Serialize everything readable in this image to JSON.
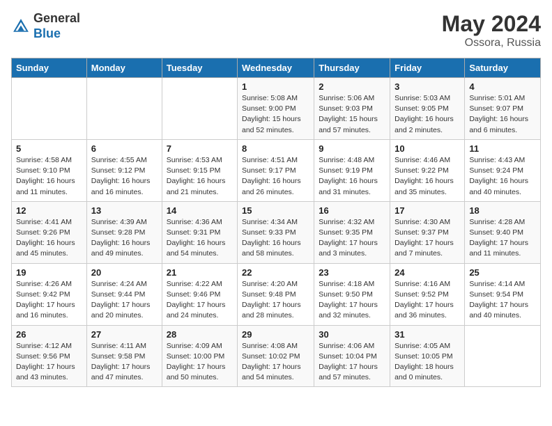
{
  "logo": {
    "general": "General",
    "blue": "Blue"
  },
  "title": {
    "month_year": "May 2024",
    "location": "Ossora, Russia"
  },
  "weekdays": [
    "Sunday",
    "Monday",
    "Tuesday",
    "Wednesday",
    "Thursday",
    "Friday",
    "Saturday"
  ],
  "weeks": [
    [
      {
        "day": "",
        "info": ""
      },
      {
        "day": "",
        "info": ""
      },
      {
        "day": "",
        "info": ""
      },
      {
        "day": "1",
        "info": "Sunrise: 5:08 AM\nSunset: 9:00 PM\nDaylight: 15 hours\nand 52 minutes."
      },
      {
        "day": "2",
        "info": "Sunrise: 5:06 AM\nSunset: 9:03 PM\nDaylight: 15 hours\nand 57 minutes."
      },
      {
        "day": "3",
        "info": "Sunrise: 5:03 AM\nSunset: 9:05 PM\nDaylight: 16 hours\nand 2 minutes."
      },
      {
        "day": "4",
        "info": "Sunrise: 5:01 AM\nSunset: 9:07 PM\nDaylight: 16 hours\nand 6 minutes."
      }
    ],
    [
      {
        "day": "5",
        "info": "Sunrise: 4:58 AM\nSunset: 9:10 PM\nDaylight: 16 hours\nand 11 minutes."
      },
      {
        "day": "6",
        "info": "Sunrise: 4:55 AM\nSunset: 9:12 PM\nDaylight: 16 hours\nand 16 minutes."
      },
      {
        "day": "7",
        "info": "Sunrise: 4:53 AM\nSunset: 9:15 PM\nDaylight: 16 hours\nand 21 minutes."
      },
      {
        "day": "8",
        "info": "Sunrise: 4:51 AM\nSunset: 9:17 PM\nDaylight: 16 hours\nand 26 minutes."
      },
      {
        "day": "9",
        "info": "Sunrise: 4:48 AM\nSunset: 9:19 PM\nDaylight: 16 hours\nand 31 minutes."
      },
      {
        "day": "10",
        "info": "Sunrise: 4:46 AM\nSunset: 9:22 PM\nDaylight: 16 hours\nand 35 minutes."
      },
      {
        "day": "11",
        "info": "Sunrise: 4:43 AM\nSunset: 9:24 PM\nDaylight: 16 hours\nand 40 minutes."
      }
    ],
    [
      {
        "day": "12",
        "info": "Sunrise: 4:41 AM\nSunset: 9:26 PM\nDaylight: 16 hours\nand 45 minutes."
      },
      {
        "day": "13",
        "info": "Sunrise: 4:39 AM\nSunset: 9:28 PM\nDaylight: 16 hours\nand 49 minutes."
      },
      {
        "day": "14",
        "info": "Sunrise: 4:36 AM\nSunset: 9:31 PM\nDaylight: 16 hours\nand 54 minutes."
      },
      {
        "day": "15",
        "info": "Sunrise: 4:34 AM\nSunset: 9:33 PM\nDaylight: 16 hours\nand 58 minutes."
      },
      {
        "day": "16",
        "info": "Sunrise: 4:32 AM\nSunset: 9:35 PM\nDaylight: 17 hours\nand 3 minutes."
      },
      {
        "day": "17",
        "info": "Sunrise: 4:30 AM\nSunset: 9:37 PM\nDaylight: 17 hours\nand 7 minutes."
      },
      {
        "day": "18",
        "info": "Sunrise: 4:28 AM\nSunset: 9:40 PM\nDaylight: 17 hours\nand 11 minutes."
      }
    ],
    [
      {
        "day": "19",
        "info": "Sunrise: 4:26 AM\nSunset: 9:42 PM\nDaylight: 17 hours\nand 16 minutes."
      },
      {
        "day": "20",
        "info": "Sunrise: 4:24 AM\nSunset: 9:44 PM\nDaylight: 17 hours\nand 20 minutes."
      },
      {
        "day": "21",
        "info": "Sunrise: 4:22 AM\nSunset: 9:46 PM\nDaylight: 17 hours\nand 24 minutes."
      },
      {
        "day": "22",
        "info": "Sunrise: 4:20 AM\nSunset: 9:48 PM\nDaylight: 17 hours\nand 28 minutes."
      },
      {
        "day": "23",
        "info": "Sunrise: 4:18 AM\nSunset: 9:50 PM\nDaylight: 17 hours\nand 32 minutes."
      },
      {
        "day": "24",
        "info": "Sunrise: 4:16 AM\nSunset: 9:52 PM\nDaylight: 17 hours\nand 36 minutes."
      },
      {
        "day": "25",
        "info": "Sunrise: 4:14 AM\nSunset: 9:54 PM\nDaylight: 17 hours\nand 40 minutes."
      }
    ],
    [
      {
        "day": "26",
        "info": "Sunrise: 4:12 AM\nSunset: 9:56 PM\nDaylight: 17 hours\nand 43 minutes."
      },
      {
        "day": "27",
        "info": "Sunrise: 4:11 AM\nSunset: 9:58 PM\nDaylight: 17 hours\nand 47 minutes."
      },
      {
        "day": "28",
        "info": "Sunrise: 4:09 AM\nSunset: 10:00 PM\nDaylight: 17 hours\nand 50 minutes."
      },
      {
        "day": "29",
        "info": "Sunrise: 4:08 AM\nSunset: 10:02 PM\nDaylight: 17 hours\nand 54 minutes."
      },
      {
        "day": "30",
        "info": "Sunrise: 4:06 AM\nSunset: 10:04 PM\nDaylight: 17 hours\nand 57 minutes."
      },
      {
        "day": "31",
        "info": "Sunrise: 4:05 AM\nSunset: 10:05 PM\nDaylight: 18 hours\nand 0 minutes."
      },
      {
        "day": "",
        "info": ""
      }
    ]
  ]
}
